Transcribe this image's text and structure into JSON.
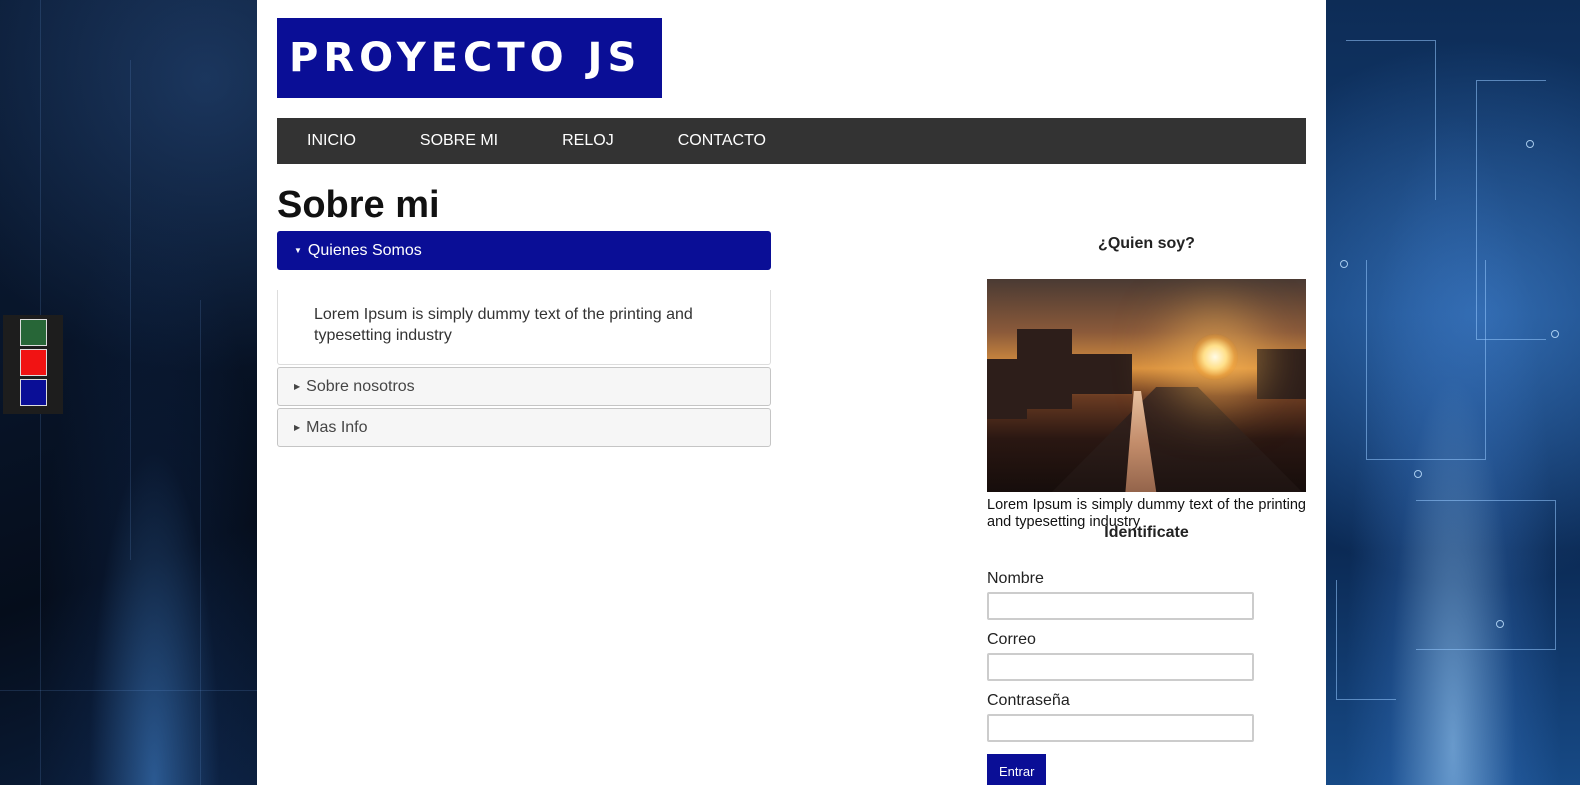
{
  "logo": {
    "text": "PROYECTO JS"
  },
  "nav": {
    "items": [
      {
        "label": "INICIO"
      },
      {
        "label": "SOBRE MI"
      },
      {
        "label": "RELOJ"
      },
      {
        "label": "CONTACTO"
      }
    ]
  },
  "page": {
    "title": "Sobre mi"
  },
  "accordion": {
    "sections": [
      {
        "title": "Quienes Somos",
        "content": "Lorem Ipsum is simply dummy text of the printing and typesetting industry",
        "expanded": true
      },
      {
        "title": "Sobre nosotros",
        "expanded": false
      },
      {
        "title": "Mas Info",
        "expanded": false
      }
    ]
  },
  "sidebar": {
    "title": "¿Quien soy?",
    "image_icon": "city-sunset-photo",
    "text": "Lorem Ipsum is simply dummy text of the printing and typesetting industry"
  },
  "form": {
    "title": "Identificate",
    "fields": {
      "name_label": "Nombre",
      "email_label": "Correo",
      "password_label": "Contraseña"
    },
    "submit_label": "Entrar"
  },
  "style_switcher": {
    "colors": [
      "#276637",
      "#f11313",
      "#0a0e96"
    ]
  },
  "colors": {
    "accent": "#0a0e96",
    "nav_bg": "#333333"
  }
}
